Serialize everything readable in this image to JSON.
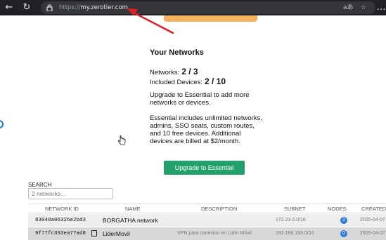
{
  "browser": {
    "url_prefix": "https://",
    "url_host": "my.zerotier.com",
    "reader_icon": "aあ",
    "star_icon": "☆",
    "more_icon": "…"
  },
  "networks_panel": {
    "title": "Your Networks",
    "networks_label": "Networks:",
    "networks_value": "2 / 3",
    "devices_label": "Included Devices:",
    "devices_value": "2 / 10",
    "upgrade_text": "Upgrade to Essential to add more networks or devices.",
    "essential_text": "Essential includes unlimited networks, admins, SSO seats, custom routes, and 10 free devices. Additional devices are billed at $2/month.",
    "upgrade_button": "Upgrade to Essential"
  },
  "search": {
    "label": "SEARCH",
    "placeholder": "2 networks..."
  },
  "table": {
    "headers": [
      "NETWORK ID",
      "NAME",
      "DESCRIPTION",
      "SUBNET",
      "NODES",
      "CREATED"
    ],
    "rows": [
      {
        "id": "83048a06326e2bd3",
        "name": "BORGATHA network",
        "description": "",
        "subnet": "172.23.0.0/16",
        "nodes": "2",
        "created": "2025-04-07"
      },
      {
        "id": "9f77fc393ea77ad8",
        "name": "LiderMovil",
        "description": "VPN para conexion en Lider Móvil",
        "subnet": "192.168.193.0/24",
        "nodes": "0",
        "created": "2025-04-07"
      }
    ]
  },
  "colors": {
    "toolbar": "#202124",
    "upgrade_button": "#22a06b",
    "top_button": "#f5b261",
    "annotation_arrow": "#e02020",
    "badge": "#2f7bd8"
  }
}
